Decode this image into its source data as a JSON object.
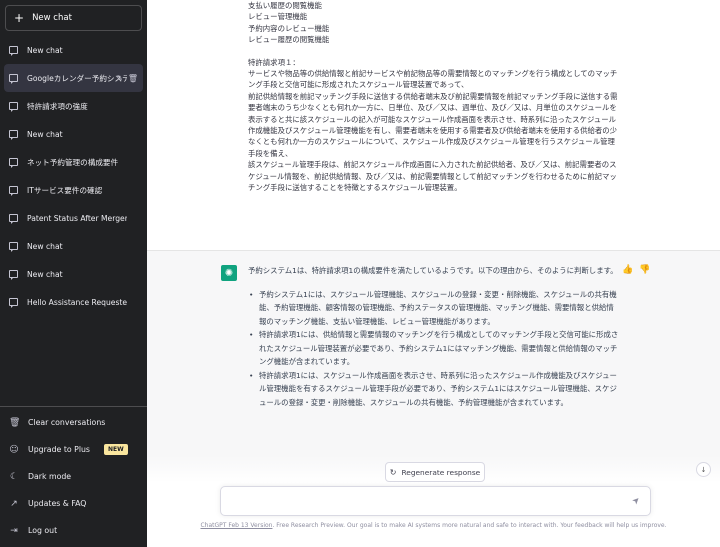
{
  "sidebar": {
    "new_chat": "New chat",
    "history": [
      {
        "label": "New chat"
      },
      {
        "label": "Googleカレンダー予約システ"
      },
      {
        "label": "特許請求項の強度"
      },
      {
        "label": "New chat"
      },
      {
        "label": "ネット予約管理の構成要件"
      },
      {
        "label": "ITサービス要件の確認"
      },
      {
        "label": "Patent Status After Merger"
      },
      {
        "label": "New chat"
      },
      {
        "label": "New chat"
      },
      {
        "label": "Hello Assistance Requested"
      }
    ],
    "bottom": {
      "clear": "Clear conversations",
      "upgrade": "Upgrade to Plus",
      "new_badge": "NEW",
      "dark": "Dark mode",
      "updates": "Updates & FAQ",
      "logout": "Log out"
    }
  },
  "user_message": {
    "lines": [
      "支払い履歴の閲覧機能",
      "レビュー管理機能",
      "予約内容のレビュー機能",
      "レビュー履歴の閲覧機能",
      "",
      "特許請求項１：",
      "サービスや物品等の供給情報と前記サービスや前記物品等の需要情報とのマッチングを行う構成としてのマッチング手段と交信可能に形成されたスケジュール管理装置であって、",
      "前記供給情報を前記マッチング手段に送信する供給者端末及び前記需要情報を前記マッチング手段に送信する需要者端末のうち少なくとも何れか一方に、日単位、及び／又は、週単位、及び／又は、月単位のスケジュールを表示すると共に該スケジュールの記入が可能なスケジュール作成画面を表示させ、時系列に沿ったスケジュール作成機能及びスケジュール管理機能を有し、需要者端末を使用する需要者及び供給者端末を使用する供給者の少なくとも何れか一方のスケジュールについて、スケジュール作成及びスケジュール管理を行うスケジュール管理手段を備え、",
      "該スケジュール管理手段は、前記スケジュール作成画面に入力された前記供給者、及び／又は、前記需要者のスケジュール情報を、前記供給情報、及び／又は、前記需要情報として前記マッチングを行わせるために前記マッチング手段に送信することを特徴とするスケジュール管理装置。"
    ]
  },
  "assistant_message": {
    "intro": "予約システム1は、特許請求項1の構成要件を満たしているようです。以下の理由から、そのように判断します。",
    "bullets": [
      "予約システム1には、スケジュール管理機能、スケジュールの登録・変更・削除機能、スケジュールの共有機能、予約管理機能、顧客情報の管理機能、予約ステータスの管理機能、マッチング機能、需要情報と供給情報のマッチング機能、支払い管理機能、レビュー管理機能があります。",
      "特許請求項1には、供給情報と需要情報のマッチングを行う構成としてのマッチング手段と交信可能に形成されたスケジュール管理装置が必要であり、予約システム1にはマッチング機能、需要情報と供給情報のマッチング機能が含まれています。",
      "特許請求項1には、スケジュール作成画面を表示させ、時系列に沿ったスケジュール作成機能及びスケジュール管理機能を有するスケジュール管理手段が必要であり、予約システム1にはスケジュール管理機能、スケジュールの登録・変更・削除機能、スケジュールの共有機能、予約管理機能が含まれています。"
    ]
  },
  "regenerate": "Regenerate response",
  "input": {
    "value": "",
    "placeholder": ""
  },
  "footer": {
    "link": "ChatGPT Feb 13 Version",
    "text": ". Free Research Preview. Our goal is to make AI systems more natural and safe to interact with. Your feedback will help us improve."
  },
  "icons": [
    "plus-icon",
    "chat-icon",
    "edit-icon",
    "trash-icon",
    "trash-icon",
    "user-icon",
    "moon-icon",
    "external-link-icon",
    "logout-icon",
    "openai-logo-icon",
    "thumbs-up-icon",
    "thumbs-down-icon",
    "refresh-icon",
    "arrow-down-icon",
    "send-icon"
  ],
  "colors": {
    "sidebar_bg": "#202123",
    "accent": "#10a37f",
    "badge": "#fae69e"
  }
}
